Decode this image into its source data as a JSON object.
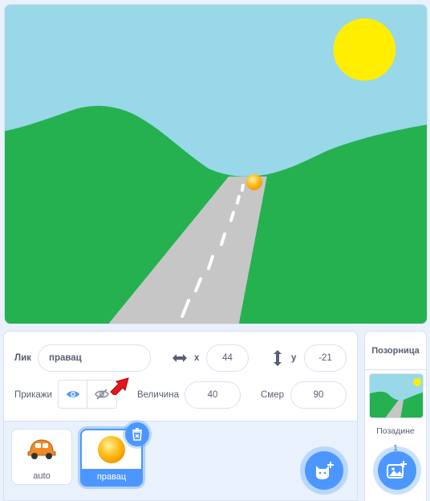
{
  "stage": {
    "colors": {
      "sky": "#98d8e9",
      "sun": "#ffee00",
      "grass": "#25b150",
      "road": "#c6c6c6",
      "road_marking": "#ffffff",
      "ball": "#ffbf1f"
    }
  },
  "sprite_info": {
    "sprite_label": "Лик",
    "sprite_name": "правац",
    "x_label": "x",
    "x_value": "44",
    "y_label": "y",
    "y_value": "-21",
    "show_label": "Прикажи",
    "size_label": "Величина",
    "size_value": "40",
    "direction_label": "Смер",
    "direction_value": "90",
    "icons": [
      "horizontal-arrows-icon",
      "vertical-arrows-icon",
      "eye-icon",
      "eye-slash-icon",
      "red-arrow-pointer-icon"
    ]
  },
  "sprites": [
    {
      "name": "auto",
      "selected": false,
      "thumb_icon": "orange-car-icon"
    },
    {
      "name": "правац",
      "selected": true,
      "thumb_icon": "yellow-ball-icon"
    }
  ],
  "sprite_controls": {
    "delete_icon": "trash-icon",
    "add_sprite_icon": "cat-plus-icon"
  },
  "stage_pane": {
    "title": "Позорница",
    "backdrops_label": "Позадине",
    "backdrops_count": "1",
    "add_backdrop_icon": "image-plus-icon"
  },
  "accent_color": "#4c97ff"
}
